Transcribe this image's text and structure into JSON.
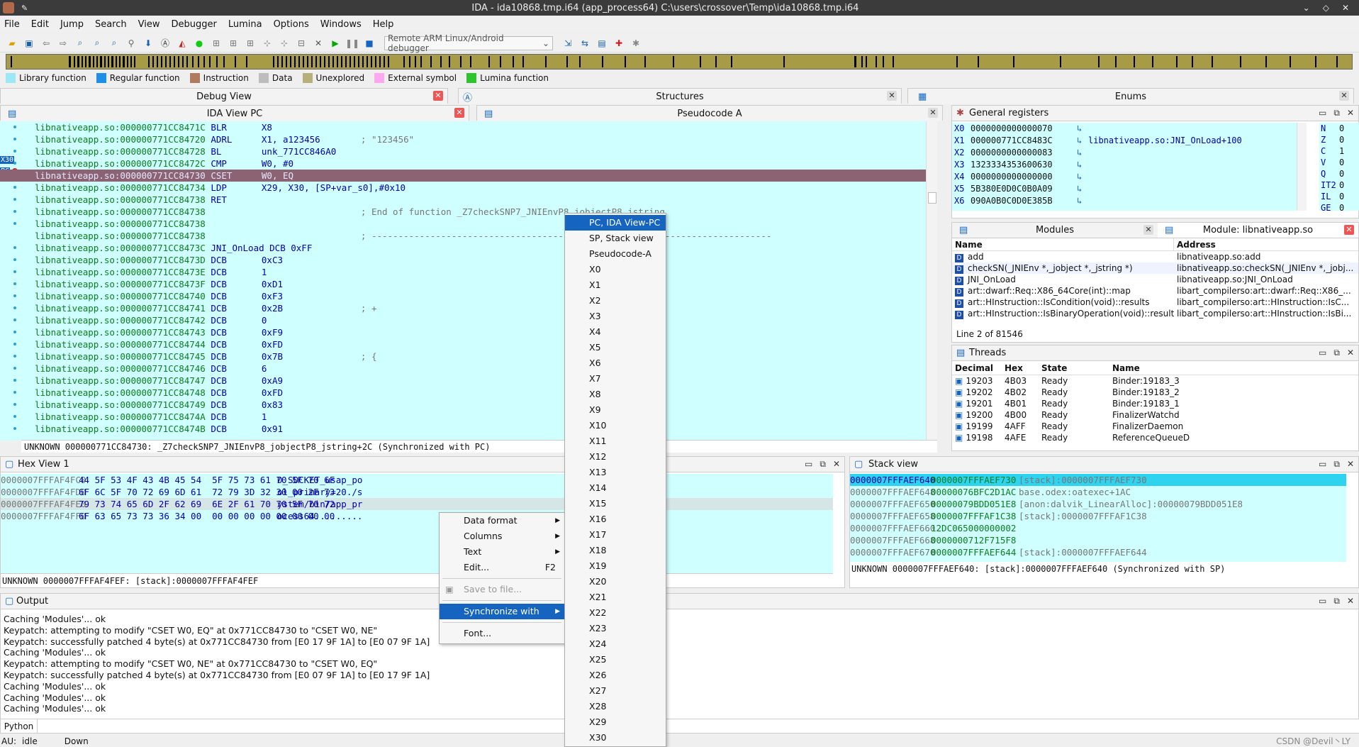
{
  "titlebar": {
    "title": "IDA - ida10868.tmp.i64 (app_process64) C:\\users\\crossover\\Temp\\ida10868.tmp.i64"
  },
  "menu": [
    "File",
    "Edit",
    "Jump",
    "Search",
    "View",
    "Debugger",
    "Lumina",
    "Options",
    "Windows",
    "Help"
  ],
  "toolbar": {
    "debugger": "Remote ARM Linux/Android debugger"
  },
  "legend": [
    {
      "label": "Library function",
      "color": "#9ce8f5"
    },
    {
      "label": "Regular function",
      "color": "#1e8fe8"
    },
    {
      "label": "Instruction",
      "color": "#b07a5e"
    },
    {
      "label": "Data",
      "color": "#bdbdbd"
    },
    {
      "label": "Unexplored",
      "color": "#b8b07a"
    },
    {
      "label": "External symbol",
      "color": "#ffa8f0"
    },
    {
      "label": "Lumina function",
      "color": "#2ec42e"
    }
  ],
  "tabs": {
    "debug_view": "Debug View",
    "structures": "Structures",
    "enums": "Enums",
    "ida_view": "IDA View PC",
    "pseudocode": "Pseudocode A"
  },
  "disasm": [
    {
      "a": "libnativeapp.so:000000771CC8471C",
      "i": "BLR",
      "o": "X8",
      "c": ""
    },
    {
      "a": "libnativeapp.so:000000771CC84720",
      "i": "ADRL",
      "o": "X1, a123456",
      "c": "; \"123456\""
    },
    {
      "a": "libnativeapp.so:000000771CC84728",
      "i": "BL",
      "o": "unk_771CC846A0",
      "c": ""
    },
    {
      "a": "libnativeapp.so:000000771CC8472C",
      "i": "CMP",
      "o": "W0, #0",
      "c": ""
    },
    {
      "a": "libnativeapp.so:000000771CC84730",
      "i": "CSET",
      "o": "W0, EQ",
      "c": "",
      "hl": true
    },
    {
      "a": "libnativeapp.so:000000771CC84734",
      "i": "LDP",
      "o": "X29, X30, [SP+var_s0],#0x10",
      "c": ""
    },
    {
      "a": "libnativeapp.so:000000771CC84738",
      "i": "RET",
      "o": "",
      "c": ""
    },
    {
      "a": "libnativeapp.so:000000771CC84738",
      "i": "",
      "o": "",
      "c": "; End of function _Z7checkSNP7_JNIEnvP8_jobjectP8_jstring"
    },
    {
      "a": "libnativeapp.so:000000771CC84738",
      "i": "",
      "o": "",
      "c": ""
    },
    {
      "a": "libnativeapp.so:000000771CC84738",
      "i": "",
      "o": "",
      "c": "; ---------------------------------------------------------------------------"
    },
    {
      "a": "libnativeapp.so:000000771CC8473C",
      "i": "JNI_OnLoad DCB",
      "o": "0xFF",
      "c": ""
    },
    {
      "a": "libnativeapp.so:000000771CC8473D",
      "i": "DCB",
      "o": "0xC3",
      "c": ""
    },
    {
      "a": "libnativeapp.so:000000771CC8473E",
      "i": "DCB",
      "o": "1",
      "c": ""
    },
    {
      "a": "libnativeapp.so:000000771CC8473F",
      "i": "DCB",
      "o": "0xD1",
      "c": ""
    },
    {
      "a": "libnativeapp.so:000000771CC84740",
      "i": "DCB",
      "o": "0xF3",
      "c": ""
    },
    {
      "a": "libnativeapp.so:000000771CC84741",
      "i": "DCB",
      "o": "0x2B",
      "c": "; +"
    },
    {
      "a": "libnativeapp.so:000000771CC84742",
      "i": "DCB",
      "o": "0",
      "c": ""
    },
    {
      "a": "libnativeapp.so:000000771CC84743",
      "i": "DCB",
      "o": "0xF9",
      "c": ""
    },
    {
      "a": "libnativeapp.so:000000771CC84744",
      "i": "DCB",
      "o": "0xFD",
      "c": ""
    },
    {
      "a": "libnativeapp.so:000000771CC84745",
      "i": "DCB",
      "o": "0x7B",
      "c": "; {"
    },
    {
      "a": "libnativeapp.so:000000771CC84746",
      "i": "DCB",
      "o": "6",
      "c": ""
    },
    {
      "a": "libnativeapp.so:000000771CC84747",
      "i": "DCB",
      "o": "0xA9",
      "c": ""
    },
    {
      "a": "libnativeapp.so:000000771CC84748",
      "i": "DCB",
      "o": "0xFD",
      "c": ""
    },
    {
      "a": "libnativeapp.so:000000771CC84749",
      "i": "DCB",
      "o": "0x83",
      "c": ""
    },
    {
      "a": "libnativeapp.so:000000771CC8474A",
      "i": "DCB",
      "o": "1",
      "c": ""
    },
    {
      "a": "libnativeapp.so:000000771CC8474B",
      "i": "DCB",
      "o": "0x91",
      "c": ""
    }
  ],
  "disasm_status": "UNKNOWN 000000771CC84730: _Z7checkSNP7_JNIEnvP8_jobjectP8_jstring+2C (Synchronized with PC)",
  "gutter": {
    "x30": "X30",
    "pc": "PC"
  },
  "registers": {
    "title": "General registers",
    "rows": [
      {
        "n": "X0",
        "v": "0000000000000070",
        "d": ""
      },
      {
        "n": "X1",
        "v": "000000771CC8483C",
        "d": "libnativeapp.so:JNI_OnLoad+100"
      },
      {
        "n": "X2",
        "v": "0000000000000083",
        "d": ""
      },
      {
        "n": "X3",
        "v": "1323334353600630",
        "d": ""
      },
      {
        "n": "X4",
        "v": "0000000000000000",
        "d": ""
      },
      {
        "n": "X5",
        "v": "5B380E0D0C0B0A09",
        "d": ""
      },
      {
        "n": "X6",
        "v": "090A0B0C0D0E385B",
        "d": ""
      }
    ],
    "flags": [
      {
        "n": "N",
        "v": "0"
      },
      {
        "n": "Z",
        "v": "0"
      },
      {
        "n": "C",
        "v": "1"
      },
      {
        "n": "V",
        "v": "0"
      },
      {
        "n": "Q",
        "v": "0"
      },
      {
        "n": "IT2",
        "v": "0"
      },
      {
        "n": "IL",
        "v": "0"
      },
      {
        "n": "GE",
        "v": "0"
      }
    ]
  },
  "modules": {
    "tab1": "Modules",
    "tab2": "Module: libnativeapp.so",
    "h_name": "Name",
    "h_addr": "Address",
    "rows": [
      {
        "n": "add",
        "a": "libnativeapp.so:add"
      },
      {
        "n": "checkSN(_JNIEnv *,_jobject *,_jstring *)",
        "a": "libnativeapp.so:checkSN(_JNIEnv *,_jobj..."
      },
      {
        "n": "JNI_OnLoad",
        "a": "libnativeapp.so:JNI_OnLoad"
      },
      {
        "n": "art::dwarf::Req::X86_64Core(int)::map",
        "a": "libart_compilerso:art::dwarf::Req::X86_..."
      },
      {
        "n": "art::HInstruction::IsCondition(void)::results",
        "a": "libart_compilerso:art::HInstruction::IsC..."
      },
      {
        "n": "art::HInstruction::IsBinaryOperation(void)::results",
        "a": "libart_compilerso:art::HInstruction::IsBi..."
      }
    ],
    "status": "Line 2 of 81546"
  },
  "threads": {
    "title": "Threads",
    "headers": [
      "Decimal",
      "Hex",
      "State",
      "Name"
    ],
    "rows": [
      [
        "19203",
        "4B03",
        "Ready",
        "Binder:19183_3"
      ],
      [
        "19202",
        "4B02",
        "Ready",
        "Binder:19183_2"
      ],
      [
        "19201",
        "4B01",
        "Ready",
        "Binder:19183_1"
      ],
      [
        "19200",
        "4B00",
        "Ready",
        "FinalizerWatchd"
      ],
      [
        "19199",
        "4AFF",
        "Ready",
        "FinalizerDaemon"
      ],
      [
        "19198",
        "4AFE",
        "Ready",
        "ReferenceQueueD"
      ]
    ]
  },
  "hex": {
    "title": "Hex View 1",
    "rows": [
      {
        "a": "0000007FFFAF4FC0",
        "b": "44 5F 53 4F 43 4B 45 54  5F 75 73 61 70 5F 70 6F",
        "t": "D_SOCKET_usap_po"
      },
      {
        "a": "0000007FFFAF4FD0",
        "b": "6F 6C 5F 70 72 69 6D 61  72 79 3D 32 30 00 2F 73",
        "t": "ol_primary=20./s"
      },
      {
        "a": "0000007FFFAF4FE0",
        "b": "79 73 74 65 6D 2F 62 69  6E 2F 61 70 70 5F 70 72",
        "t": "ystem/bin/app_pr"
      },
      {
        "a": "0000007FFFAF4FF0",
        "b": "6F 63 65 73 73 36 34 00  00 00 00 00 00 00 00 00",
        "t": "ocess64........."
      }
    ],
    "status": "UNKNOWN 0000007FFFAF4FEF: [stack]:0000007FFFAF4FEF"
  },
  "stack": {
    "title": "Stack view",
    "rows": [
      {
        "a": "0000007FFFAEF640",
        "v": "0000007FFFAEF730",
        "d": "[stack]:0000007FFFAEF730"
      },
      {
        "a": "0000007FFFAEF648",
        "v": "00000076BFC2D1AC",
        "d": "base.odex:oatexec+1AC"
      },
      {
        "a": "0000007FFFAEF650",
        "v": "00000079BDD051E8",
        "d": "[anon:dalvik_LinearAlloc]:00000079BDD051E8"
      },
      {
        "a": "0000007FFFAEF658",
        "v": "0000007FFFAF1C38",
        "d": "[stack]:0000007FFFAF1C38"
      },
      {
        "a": "0000007FFFAEF660",
        "v": "12DC065000000002",
        "d": ""
      },
      {
        "a": "0000007FFFAEF668",
        "v": "0000000712F715F8",
        "d": ""
      },
      {
        "a": "0000007FFFAEF670",
        "v": "0000007FFFAEF644",
        "d": "[stack]:0000007FFFAEF644"
      }
    ],
    "status": "UNKNOWN 0000007FFFAEF640: [stack]:0000007FFFAEF640 (Synchronized with SP)"
  },
  "output": {
    "title": "Output",
    "lines": [
      "Caching 'Modules'... ok",
      "Keypatch: attempting to modify \"CSET W0, EQ\" at 0x771CC84730 to \"CSET W0, NE\"",
      "Keypatch: successfully patched 4 byte(s) at 0x771CC84730 from [E0 17 9F 1A] to [E0 07 9F 1A]",
      "Caching 'Modules'... ok",
      "Keypatch: attempting to modify \"CSET W0, NE\" at 0x771CC84730 to \"CSET W0, EQ\"",
      "Keypatch: successfully patched 4 byte(s) at 0x771CC84730 from [E0 07 9F 1A] to [E0 17 9F 1A]",
      "Caching 'Modules'... ok",
      "Caching 'Modules'... ok",
      "Caching 'Modules'... ok"
    ],
    "python": "Python"
  },
  "statusbar": {
    "au": "AU:",
    "state": "idle",
    "dir": "Down",
    "watermark": "CSDN @Devil丶LY"
  },
  "ctxmenu": [
    {
      "l": "Data format",
      "sub": true
    },
    {
      "l": "Columns",
      "sub": true
    },
    {
      "l": "Text",
      "sub": true
    },
    {
      "l": "Edit...",
      "key": "F2"
    },
    {
      "l": "Save to file...",
      "dis": true
    },
    {
      "l": "Synchronize with",
      "sub": true,
      "sel": true
    },
    {
      "l": "Font..."
    }
  ],
  "submenu": [
    "PC, IDA View-PC",
    "SP, Stack view",
    "Pseudocode-A",
    "X0",
    "X1",
    "X2",
    "X3",
    "X4",
    "X5",
    "X6",
    "X7",
    "X8",
    "X9",
    "X10",
    "X11",
    "X12",
    "X13",
    "X14",
    "X15",
    "X16",
    "X17",
    "X18",
    "X19",
    "X20",
    "X21",
    "X22",
    "X23",
    "X24",
    "X25",
    "X26",
    "X27",
    "X28",
    "X29",
    "X30"
  ]
}
